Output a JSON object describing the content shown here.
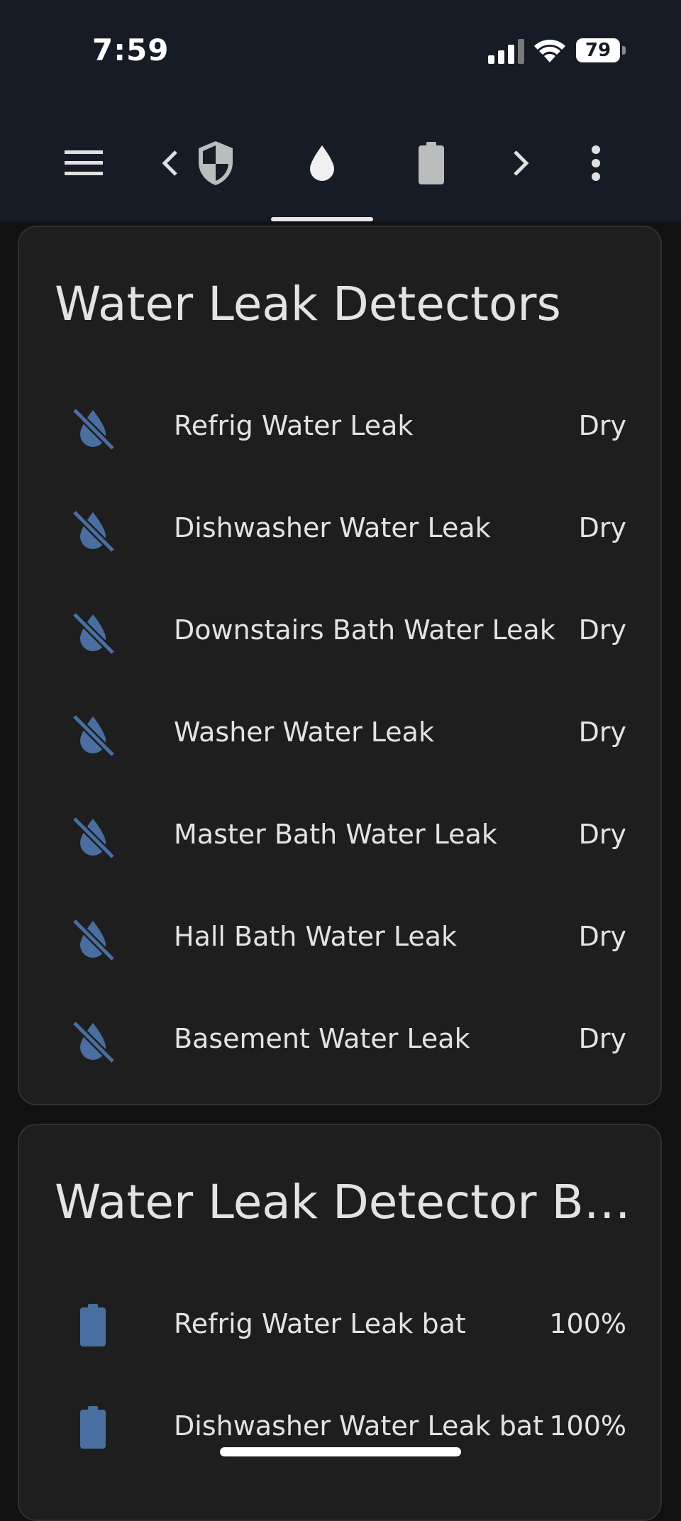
{
  "status_bar": {
    "time": "7:59",
    "battery": "79"
  },
  "toolbar": {
    "icons": [
      "menu-icon",
      "chevron-left-icon",
      "shield-icon",
      "water-drop-icon",
      "battery-icon",
      "chevron-right-icon",
      "more-vert-icon"
    ],
    "active_tab": "water-drop-icon"
  },
  "leak_card": {
    "title": "Water Leak Detectors",
    "rows": [
      {
        "name": "Refrig Water Leak",
        "state": "Dry"
      },
      {
        "name": "Dishwasher Water Leak",
        "state": "Dry"
      },
      {
        "name": "Downstairs Bath Water Leak",
        "state": "Dry"
      },
      {
        "name": "Washer Water Leak",
        "state": "Dry"
      },
      {
        "name": "Master Bath Water Leak",
        "state": "Dry"
      },
      {
        "name": "Hall Bath Water Leak",
        "state": "Dry"
      },
      {
        "name": "Basement Water Leak",
        "state": "Dry"
      }
    ]
  },
  "battery_card": {
    "title": "Water Leak Detector Bat...",
    "rows": [
      {
        "name": "Refrig Water Leak bat",
        "state": "100%"
      },
      {
        "name": "Dishwasher Water Leak bat",
        "state": "100%"
      }
    ]
  },
  "colors": {
    "icon_blue": "#4a6ea0",
    "background": "#111111",
    "card": "#1e1e1e",
    "header": "#151c26"
  }
}
